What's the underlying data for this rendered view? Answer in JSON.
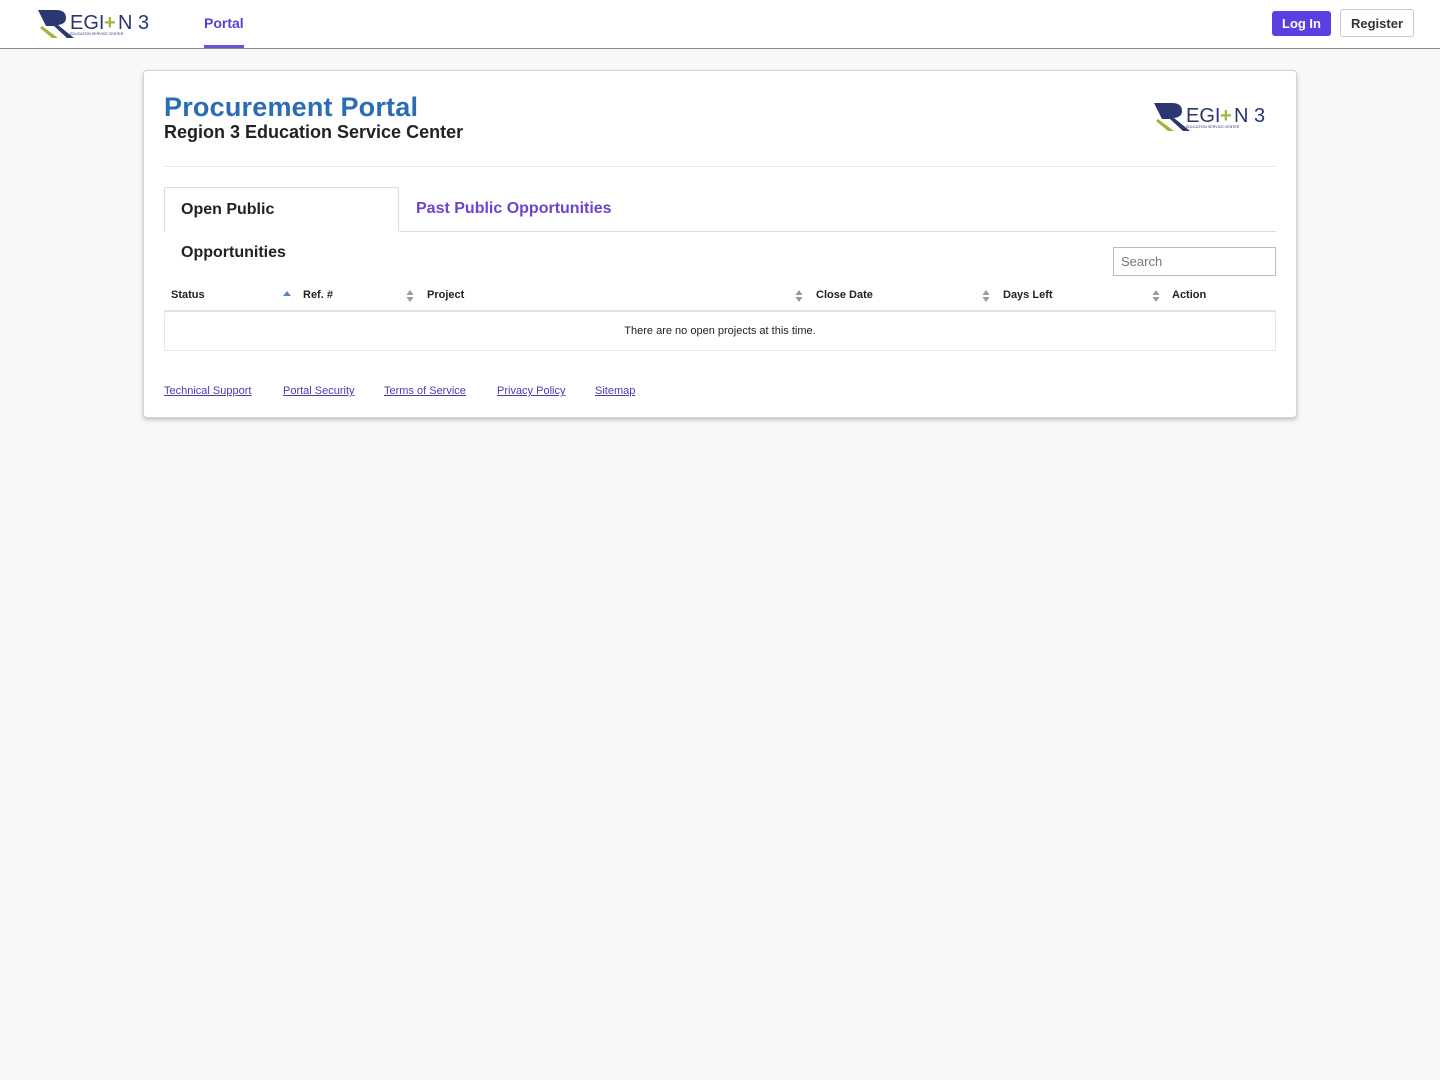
{
  "brand": {
    "logo_text": "REGI+N 3",
    "logo_tagline": "EDUCATION SERVICE CENTER"
  },
  "nav": {
    "portal_label": "Portal",
    "login_label": "Log In",
    "register_label": "Register"
  },
  "header": {
    "title": "Procurement Portal",
    "subtitle": "Region 3 Education Service Center"
  },
  "tabs": [
    {
      "label": "Open Public Opportunities",
      "active": true
    },
    {
      "label": "Past Public Opportunities",
      "active": false
    }
  ],
  "search": {
    "placeholder": "Search",
    "value": ""
  },
  "table": {
    "columns": [
      "Status",
      "Ref. #",
      "Project",
      "Close Date",
      "Days Left",
      "Action"
    ],
    "sorted_column": "Status",
    "sort_direction": "ascending",
    "empty_message": "There are no open projects at this time."
  },
  "footer": {
    "links": [
      "Technical Support",
      "Portal Security",
      "Terms of Service",
      "Privacy Policy",
      "Sitemap"
    ]
  },
  "colors": {
    "accent": "#5c3fe0",
    "title_blue": "#2a6db3",
    "logo_navy": "#2b3770",
    "logo_green": "#a3b43a"
  }
}
